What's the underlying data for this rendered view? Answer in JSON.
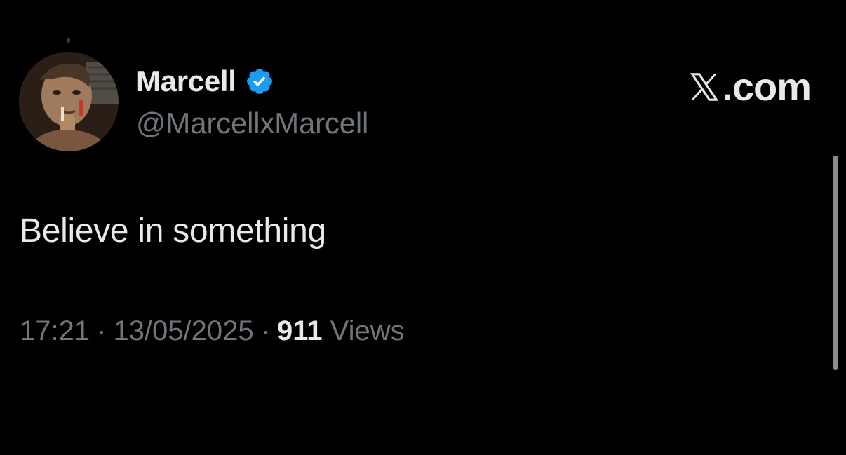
{
  "author": {
    "display_name": "Marcell",
    "handle": "@MarcellxMarcell",
    "verified": true,
    "avatar_icon": "avatar-photo-icon"
  },
  "brand": {
    "label": ".com",
    "logo_icon": "x-logo-icon"
  },
  "tweet": {
    "text": "Believe in something",
    "time": "17:21",
    "separator": "·",
    "date": "13/05/2025",
    "views_count": "911",
    "views_label": "Views"
  },
  "colors": {
    "background": "#000000",
    "primary_text": "#e7e9ea",
    "secondary_text": "#71767b",
    "verified_blue": "#1d9bf0"
  }
}
